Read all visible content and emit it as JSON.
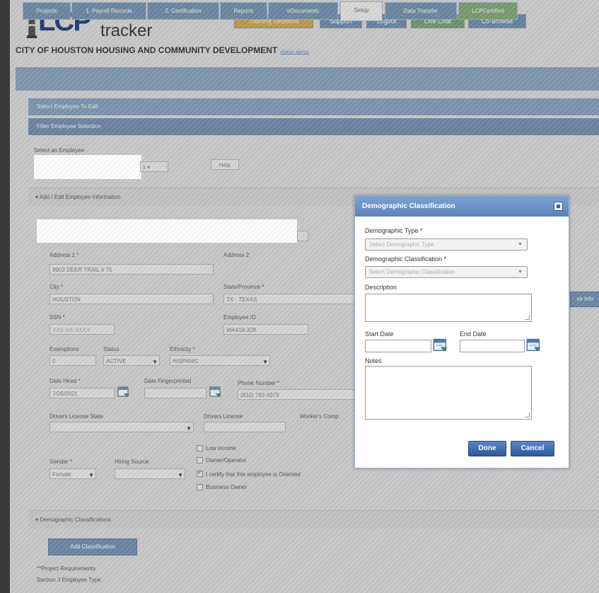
{
  "header": {
    "logo_main": "LCP",
    "logo_sub": "tracker",
    "org_title": "CITY OF HOUSTON HOUSING AND COMMUNITY DEVELOPMENT",
    "top_buttons": [
      "Training Sessions",
      "Support",
      "Logout",
      "Live Chat",
      "Co-Browse"
    ]
  },
  "tabs": [
    {
      "label": "Projects"
    },
    {
      "label": "1. Payroll Records"
    },
    {
      "label": "2. Certification"
    },
    {
      "label": "Reports"
    },
    {
      "label": "eDocuments"
    },
    {
      "label": "Setup"
    },
    {
      "label": "Data Transfer"
    },
    {
      "label": "LCPCertified"
    }
  ],
  "panels": {
    "select_employee": "Select Employee To Edit",
    "filter_employee": "Filter Employee Selection",
    "select_label": "Select an Employee",
    "help_button": "Help",
    "add_edit_section": "Add / Edit Employee Information",
    "demographic_section": "Demographic Classifications",
    "add_classification_button": "Add Classification",
    "project_requirements": "**Project Requirements",
    "section3_type": "Section 3 Employee Type"
  },
  "form": {
    "address1_label": "Address 1 *",
    "address1_value": "9903 DEER TRAIL # 75",
    "address2_label": "Address 2",
    "city_label": "City *",
    "city_value": "HOUSTON",
    "state_label": "State/Province *",
    "state_value": "TX - TEXAS",
    "ssn_label": "SSN *",
    "ssn_value": "XXX-XX-XXXX",
    "employee_id_label": "Employee ID",
    "employee_id_value": "WA419-328",
    "exemptions_label": "Exemptions",
    "exemptions_value": "0",
    "status_label": "Status",
    "status_value": "ACTIVE",
    "ethnicity_label": "Ethnicity *",
    "ethnicity_value": "HISPANIC",
    "date_hired_label": "Date Hired *",
    "date_hired_value": "7/26/2021",
    "date_fingerprinted_label": "Date Fingerprinted",
    "phone_label": "Phone Number *",
    "phone_value": "(832) 763-6979",
    "dl_state_label": "Drivers License State",
    "dl_label": "Drivers License",
    "workers_comp_label": "Worker's Comp",
    "gender_label": "Gender *",
    "gender_value": "Female",
    "hiring_source_label": "Hiring Source",
    "checks": [
      {
        "label": "Low income",
        "checked": false
      },
      {
        "label": "Owner/Operator",
        "checked": false
      },
      {
        "label": "I certify that this employee is Oriented",
        "checked": true
      },
      {
        "label": "Business Owner",
        "checked": false
      }
    ],
    "save_partial": "ve Info"
  },
  "modal": {
    "title": "Demographic Classification",
    "demo_type_label": "Demographic Type *",
    "demo_type_placeholder": "Select Demographic Type",
    "demo_class_label": "Demographic Classification *",
    "demo_class_placeholder": "Select Demographic Classification",
    "description_label": "Description",
    "start_date_label": "Start Date",
    "end_date_label": "End Date",
    "notes_label": "Notes",
    "done_button": "Done",
    "cancel_button": "Cancel"
  },
  "colors": {
    "brand": "#1e3c6e",
    "nav": "#7f96ad",
    "modal_header": "#5b84bd",
    "button": "#2c5aa0"
  }
}
